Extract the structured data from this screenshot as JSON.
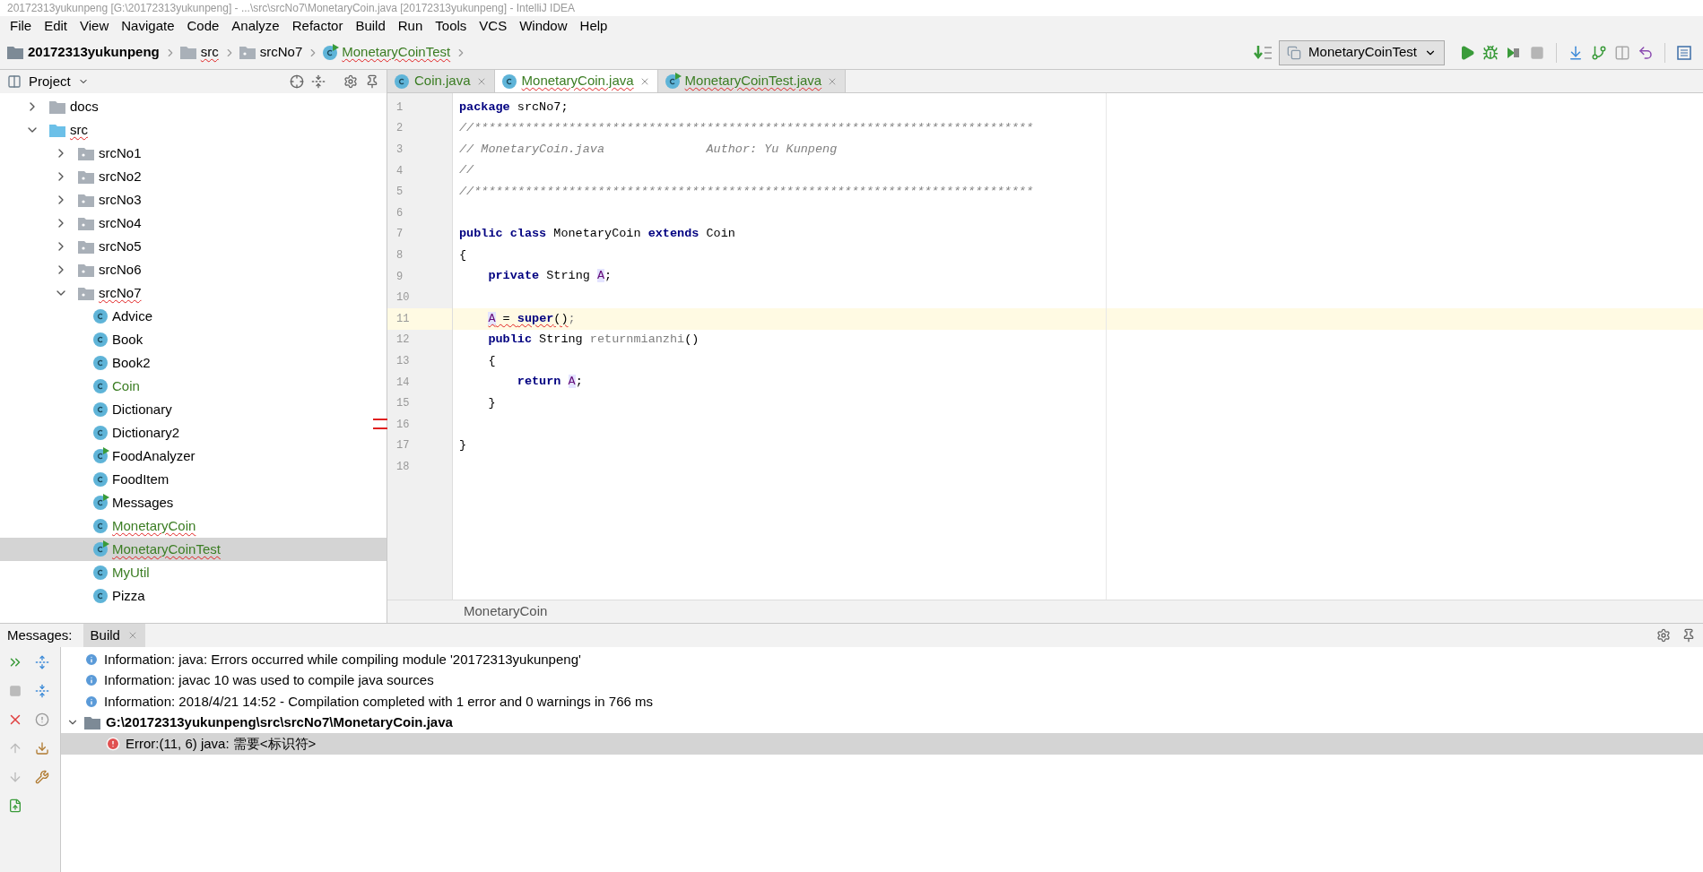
{
  "window": {
    "title": "20172313yukunpeng [G:\\20172313yukunpeng] - ...\\src\\srcNo7\\MonetaryCoin.java [20172313yukunpeng] - IntelliJ IDEA"
  },
  "menu": [
    "File",
    "Edit",
    "View",
    "Navigate",
    "Code",
    "Analyze",
    "Refactor",
    "Build",
    "Run",
    "Tools",
    "VCS",
    "Window",
    "Help"
  ],
  "breadcrumb": [
    {
      "label": "20172313yukunpeng",
      "kind": "project",
      "error": false
    },
    {
      "label": "src",
      "kind": "folder",
      "error": true
    },
    {
      "label": "srcNo7",
      "kind": "package",
      "error": false
    },
    {
      "label": "MonetaryCoinTest",
      "kind": "runnable",
      "error": true
    }
  ],
  "run_config": {
    "label": "MonetaryCoinTest"
  },
  "project_panel": {
    "title": "Project"
  },
  "tree": [
    {
      "label": "docs",
      "kind": "folder",
      "expanded": false,
      "error": false,
      "selected": false
    },
    {
      "label": "src",
      "kind": "source",
      "expanded": true,
      "error": true,
      "selected": false,
      "children": [
        {
          "label": "srcNo1",
          "kind": "package",
          "expanded": false,
          "error": false,
          "selected": false
        },
        {
          "label": "srcNo2",
          "kind": "package",
          "expanded": false,
          "error": false,
          "selected": false
        },
        {
          "label": "srcNo3",
          "kind": "package",
          "expanded": false,
          "error": false,
          "selected": false
        },
        {
          "label": "srcNo4",
          "kind": "package",
          "expanded": false,
          "error": false,
          "selected": false
        },
        {
          "label": "srcNo5",
          "kind": "package",
          "expanded": false,
          "error": false,
          "selected": false
        },
        {
          "label": "srcNo6",
          "kind": "package",
          "expanded": false,
          "error": false,
          "selected": false
        },
        {
          "label": "srcNo7",
          "kind": "package",
          "expanded": true,
          "error": true,
          "selected": false,
          "children": [
            {
              "label": "Advice",
              "kind": "class",
              "color": "#000000",
              "error": false,
              "selected": false
            },
            {
              "label": "Book",
              "kind": "class",
              "color": "#000000",
              "error": false,
              "selected": false
            },
            {
              "label": "Book2",
              "kind": "class",
              "color": "#000000",
              "error": false,
              "selected": false
            },
            {
              "label": "Coin",
              "kind": "class",
              "color": "#3b7d23",
              "error": false,
              "selected": false
            },
            {
              "label": "Dictionary",
              "kind": "class",
              "color": "#000000",
              "error": false,
              "selected": false
            },
            {
              "label": "Dictionary2",
              "kind": "class",
              "color": "#000000",
              "error": false,
              "selected": false
            },
            {
              "label": "FoodAnalyzer",
              "kind": "runnable",
              "color": "#000000",
              "error": false,
              "selected": false
            },
            {
              "label": "FoodItem",
              "kind": "class",
              "color": "#000000",
              "error": false,
              "selected": false
            },
            {
              "label": "Messages",
              "kind": "runnable",
              "color": "#000000",
              "error": false,
              "selected": false
            },
            {
              "label": "MonetaryCoin",
              "kind": "class",
              "color": "#3b7d23",
              "error": true,
              "selected": false
            },
            {
              "label": "MonetaryCoinTest",
              "kind": "runnable",
              "color": "#3b7d23",
              "error": true,
              "selected": true
            },
            {
              "label": "MyUtil",
              "kind": "class",
              "color": "#3b7d23",
              "error": false,
              "selected": false
            },
            {
              "label": "Pizza",
              "kind": "class",
              "color": "#000000",
              "error": false,
              "selected": false
            }
          ]
        }
      ]
    }
  ],
  "tabs": [
    {
      "label": "Coin.java",
      "kind": "class",
      "color": "#3b7d23",
      "error": false,
      "selected": false
    },
    {
      "label": "MonetaryCoin.java",
      "kind": "class",
      "color": "#3b7d23",
      "error": true,
      "selected": true
    },
    {
      "label": "MonetaryCoinTest.java",
      "kind": "runnable",
      "color": "#3b7d23",
      "error": true,
      "selected": false
    }
  ],
  "code": [
    {
      "number": "1",
      "current": false,
      "tokens": [
        {
          "text": "package",
          "kind": "keyword"
        },
        {
          "text": " srcNo7;",
          "kind": "plain"
        }
      ]
    },
    {
      "number": "2",
      "current": false,
      "tokens": [
        {
          "text": "//*****************************************************************************",
          "kind": "comment"
        }
      ]
    },
    {
      "number": "3",
      "current": false,
      "tokens": [
        {
          "text": "// MonetaryCoin.java              Author: Yu Kunpeng",
          "kind": "comment"
        }
      ]
    },
    {
      "number": "4",
      "current": false,
      "tokens": [
        {
          "text": "//",
          "kind": "comment"
        }
      ]
    },
    {
      "number": "5",
      "current": false,
      "tokens": [
        {
          "text": "//*****************************************************************************",
          "kind": "comment"
        }
      ]
    },
    {
      "number": "6",
      "current": false
    },
    {
      "number": "7",
      "current": false,
      "tokens": [
        {
          "text": "public class",
          "kind": "keyword"
        },
        {
          "text": " MonetaryCoin ",
          "kind": "plain"
        },
        {
          "text": "extends",
          "kind": "keyword"
        },
        {
          "text": " Coin",
          "kind": "plain"
        }
      ]
    },
    {
      "number": "8",
      "current": false,
      "tokens": [
        {
          "text": "{",
          "kind": "plain"
        }
      ]
    },
    {
      "number": "9",
      "current": false,
      "tokens": [
        {
          "text": "    private",
          "kind": "keyword"
        },
        {
          "text": " String ",
          "kind": "plain"
        },
        {
          "text": "A",
          "kind": "field"
        },
        {
          "text": ";",
          "kind": "plain"
        }
      ]
    },
    {
      "number": "10",
      "current": false
    },
    {
      "number": "11",
      "current": true,
      "tokens": [
        {
          "text": "    A",
          "kind": "error_field"
        },
        {
          "text": " = ",
          "kind": "error"
        },
        {
          "text": "super",
          "kind": "error_keyword"
        },
        {
          "text": "()",
          "kind": "error"
        },
        {
          "text": ";",
          "kind": "unused"
        }
      ]
    },
    {
      "number": "12",
      "current": false,
      "tokens": [
        {
          "text": "    public",
          "kind": "keyword"
        },
        {
          "text": " String ",
          "kind": "plain"
        },
        {
          "text": "returnmianzhi",
          "kind": "unused"
        },
        {
          "text": "()",
          "kind": "plain"
        }
      ]
    },
    {
      "number": "13",
      "current": false,
      "tokens": [
        {
          "text": "    {",
          "kind": "plain"
        }
      ]
    },
    {
      "number": "14",
      "current": false,
      "tokens": [
        {
          "text": "        return ",
          "kind": "keyword"
        },
        {
          "text": "A",
          "kind": "field"
        },
        {
          "text": ";",
          "kind": "plain"
        }
      ]
    },
    {
      "number": "15",
      "current": false,
      "tokens": [
        {
          "text": "    }",
          "kind": "plain"
        }
      ]
    },
    {
      "number": "16",
      "current": false
    },
    {
      "number": "17",
      "current": false,
      "tokens": [
        {
          "text": "}",
          "kind": "plain"
        }
      ]
    },
    {
      "number": "18",
      "current": false
    }
  ],
  "editor_breadcrumb": "MonetaryCoin",
  "messages": {
    "label": "Messages:",
    "tabs": [
      {
        "label": "Build",
        "selected": true
      }
    ],
    "rows": [
      {
        "kind": "info",
        "text": "Information: java: Errors occurred while compiling module '20172313yukunpeng'",
        "selected": false
      },
      {
        "kind": "info",
        "text": "Information: javac 10 was used to compile java sources",
        "selected": false
      },
      {
        "kind": "info",
        "text": "Information: 2018/4/21 14:52 - Compilation completed with 1 error and 0 warnings in 766 ms",
        "selected": false
      },
      {
        "kind": "file",
        "text": "G:\\20172313yukunpeng\\src\\srcNo7\\MonetaryCoin.java",
        "selected": false
      },
      {
        "kind": "error",
        "text": "Error:(11, 6)  java: 需要<标识符>",
        "selected": true
      }
    ]
  }
}
